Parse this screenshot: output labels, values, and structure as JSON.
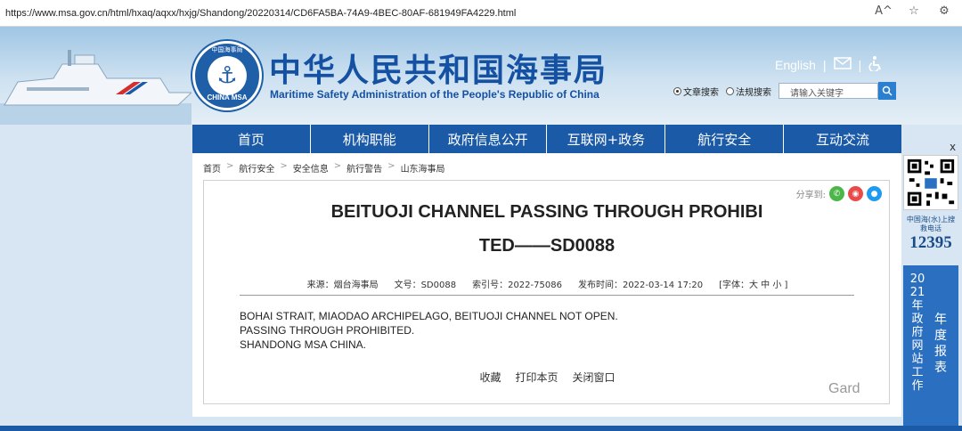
{
  "browser": {
    "url": "https://www.msa.gov.cn/html/hxaq/aqxx/hxjg/Shandong/20220314/CD6FA5BA-74A9-4BEC-80AF-681949FA4229.html",
    "tools": [
      "A^",
      "☆",
      "⚙"
    ]
  },
  "header": {
    "cn_title": "中华人民共和国海事局",
    "en_title": "Maritime Safety Administration of the People's Republic of China",
    "logo_top": "中国海事局",
    "logo_bottom": "CHINA MSA",
    "english_link": "English",
    "search": {
      "option1": "文章搜索",
      "option2": "法规搜索",
      "placeholder": "请输入关键字"
    }
  },
  "nav": {
    "items": [
      "首页",
      "机构职能",
      "政府信息公开",
      "互联网+政务",
      "航行安全",
      "互动交流"
    ]
  },
  "breadcrumb": [
    "首页",
    "航行安全",
    "安全信息",
    "航行警告",
    "山东海事局"
  ],
  "article": {
    "share_label": "分享到:",
    "title_line1": "BEITUOJI CHANNEL PASSING THROUGH PROHIBI",
    "title_line2": "TED——SD0088",
    "meta": {
      "source": "来源：烟台海事局",
      "doc_no": "文号：SD0088",
      "index_no": "索引号：2022-75086",
      "publish_time": "发布时间：2022-03-14 17:20",
      "font_size": "[字体：大 中 小 ]"
    },
    "body_lines": [
      "BOHAI STRAIT,  MIAODAO ARCHIPELAGO,  BEITUOJI CHANNEL NOT OPEN.",
      "PASSING  THROUGH  PROHIBITED.",
      "SHANDONG MSA CHINA."
    ],
    "actions": [
      "收藏",
      "打印本页",
      "关闭窗口"
    ]
  },
  "side_panel": {
    "close": "x",
    "hotline_label": "中国海(水)上搜救电话",
    "hotline_number": "12395",
    "report_year": "2021年",
    "report_text": "年度报表",
    "report_sub": "政府网站工作"
  },
  "watermark": "Gard",
  "colors": {
    "primary_blue": "#1b5aa7",
    "title_blue": "#1551a3"
  }
}
